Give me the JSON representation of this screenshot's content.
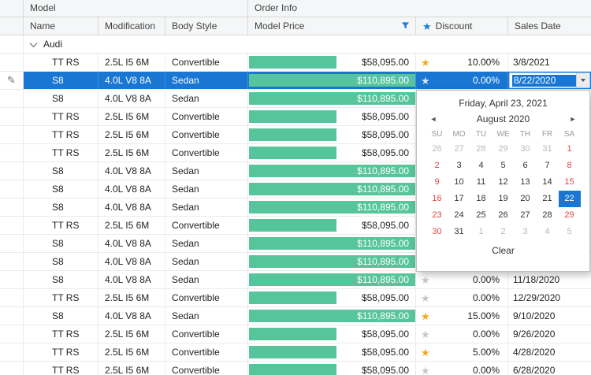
{
  "bands": {
    "model": "Model",
    "order_info": "Order Info"
  },
  "columns": {
    "name": "Name",
    "modification": "Modification",
    "body_style": "Body Style",
    "model_price": "Model Price",
    "discount": "Discount",
    "sales_date": "Sales Date"
  },
  "group": {
    "label": "Audi"
  },
  "max_price": 110895,
  "rows": [
    {
      "name": "TT RS",
      "modification": "2.5L I5 6M",
      "body_style": "Convertible",
      "price_label": "$58,095.00",
      "price_value": 58095,
      "star": "gold",
      "discount": "10.00%",
      "sales_date": "3/8/2021",
      "selected": false,
      "editing": false
    },
    {
      "name": "S8",
      "modification": "4.0L V8 8A",
      "body_style": "Sedan",
      "price_label": "$110,895.00",
      "price_value": 110895,
      "star": "light",
      "discount": "0.00%",
      "sales_date": "8/22/2020",
      "selected": true,
      "editing": true
    },
    {
      "name": "S8",
      "modification": "4.0L V8 8A",
      "body_style": "Sedan",
      "price_label": "$110,895.00",
      "price_value": 110895,
      "star": null,
      "discount": "",
      "sales_date": "",
      "selected": false,
      "editing": false
    },
    {
      "name": "TT RS",
      "modification": "2.5L I5 6M",
      "body_style": "Convertible",
      "price_label": "$58,095.00",
      "price_value": 58095,
      "star": null,
      "discount": "",
      "sales_date": "",
      "selected": false,
      "editing": false
    },
    {
      "name": "TT RS",
      "modification": "2.5L I5 6M",
      "body_style": "Convertible",
      "price_label": "$58,095.00",
      "price_value": 58095,
      "star": null,
      "discount": "",
      "sales_date": "",
      "selected": false,
      "editing": false
    },
    {
      "name": "TT RS",
      "modification": "2.5L I5 6M",
      "body_style": "Convertible",
      "price_label": "$58,095.00",
      "price_value": 58095,
      "star": null,
      "discount": "",
      "sales_date": "",
      "selected": false,
      "editing": false
    },
    {
      "name": "S8",
      "modification": "4.0L V8 8A",
      "body_style": "Sedan",
      "price_label": "$110,895.00",
      "price_value": 110895,
      "star": null,
      "discount": "",
      "sales_date": "",
      "selected": false,
      "editing": false
    },
    {
      "name": "S8",
      "modification": "4.0L V8 8A",
      "body_style": "Sedan",
      "price_label": "$110,895.00",
      "price_value": 110895,
      "star": null,
      "discount": "",
      "sales_date": "",
      "selected": false,
      "editing": false
    },
    {
      "name": "S8",
      "modification": "4.0L V8 8A",
      "body_style": "Sedan",
      "price_label": "$110,895.00",
      "price_value": 110895,
      "star": null,
      "discount": "",
      "sales_date": "",
      "selected": false,
      "editing": false
    },
    {
      "name": "TT RS",
      "modification": "2.5L I5 6M",
      "body_style": "Convertible",
      "price_label": "$58,095.00",
      "price_value": 58095,
      "star": null,
      "discount": "",
      "sales_date": "",
      "selected": false,
      "editing": false
    },
    {
      "name": "S8",
      "modification": "4.0L V8 8A",
      "body_style": "Sedan",
      "price_label": "$110,895.00",
      "price_value": 110895,
      "star": null,
      "discount": "",
      "sales_date": "",
      "selected": false,
      "editing": false
    },
    {
      "name": "S8",
      "modification": "4.0L V8 8A",
      "body_style": "Sedan",
      "price_label": "$110,895.00",
      "price_value": 110895,
      "star": null,
      "discount": "",
      "sales_date": "",
      "selected": false,
      "editing": false
    },
    {
      "name": "S8",
      "modification": "4.0L V8 8A",
      "body_style": "Sedan",
      "price_label": "$110,895.00",
      "price_value": 110895,
      "star": "gray",
      "discount": "0.00%",
      "sales_date": "11/18/2020",
      "selected": false,
      "editing": false
    },
    {
      "name": "TT RS",
      "modification": "2.5L I5 6M",
      "body_style": "Convertible",
      "price_label": "$58,095.00",
      "price_value": 58095,
      "star": "gray",
      "discount": "0.00%",
      "sales_date": "12/29/2020",
      "selected": false,
      "editing": false
    },
    {
      "name": "S8",
      "modification": "4.0L V8 8A",
      "body_style": "Sedan",
      "price_label": "$110,895.00",
      "price_value": 110895,
      "star": "gold",
      "discount": "15.00%",
      "sales_date": "9/10/2020",
      "selected": false,
      "editing": false
    },
    {
      "name": "TT RS",
      "modification": "2.5L I5 6M",
      "body_style": "Convertible",
      "price_label": "$58,095.00",
      "price_value": 58095,
      "star": "gray",
      "discount": "0.00%",
      "sales_date": "9/26/2020",
      "selected": false,
      "editing": false
    },
    {
      "name": "TT RS",
      "modification": "2.5L I5 6M",
      "body_style": "Convertible",
      "price_label": "$58,095.00",
      "price_value": 58095,
      "star": "gold",
      "discount": "5.00%",
      "sales_date": "4/28/2020",
      "selected": false,
      "editing": false
    },
    {
      "name": "TT RS",
      "modification": "2.5L I5 6M",
      "body_style": "Convertible",
      "price_label": "$58,095.00",
      "price_value": 58095,
      "star": "gray",
      "discount": "0.00%",
      "sales_date": "6/28/2020",
      "selected": false,
      "editing": false
    }
  ],
  "calendar": {
    "title": "Friday, April 23, 2021",
    "month_label": "August 2020",
    "weekdays": [
      "SU",
      "MO",
      "TU",
      "WE",
      "TH",
      "FR",
      "SA"
    ],
    "weeks": [
      [
        {
          "d": 26,
          "t": "muted"
        },
        {
          "d": 27,
          "t": "muted"
        },
        {
          "d": 28,
          "t": "muted"
        },
        {
          "d": 29,
          "t": "muted"
        },
        {
          "d": 30,
          "t": "muted"
        },
        {
          "d": 31,
          "t": "muted"
        },
        {
          "d": 1,
          "t": "weekend"
        }
      ],
      [
        {
          "d": 2,
          "t": "weekend"
        },
        {
          "d": 3,
          "t": "normal"
        },
        {
          "d": 4,
          "t": "normal"
        },
        {
          "d": 5,
          "t": "normal"
        },
        {
          "d": 6,
          "t": "normal"
        },
        {
          "d": 7,
          "t": "normal"
        },
        {
          "d": 8,
          "t": "weekend"
        }
      ],
      [
        {
          "d": 9,
          "t": "weekend"
        },
        {
          "d": 10,
          "t": "normal"
        },
        {
          "d": 11,
          "t": "normal"
        },
        {
          "d": 12,
          "t": "normal"
        },
        {
          "d": 13,
          "t": "normal"
        },
        {
          "d": 14,
          "t": "normal"
        },
        {
          "d": 15,
          "t": "weekend"
        }
      ],
      [
        {
          "d": 16,
          "t": "weekend"
        },
        {
          "d": 17,
          "t": "normal"
        },
        {
          "d": 18,
          "t": "normal"
        },
        {
          "d": 19,
          "t": "normal"
        },
        {
          "d": 20,
          "t": "normal"
        },
        {
          "d": 21,
          "t": "normal"
        },
        {
          "d": 22,
          "t": "selected"
        }
      ],
      [
        {
          "d": 23,
          "t": "weekend"
        },
        {
          "d": 24,
          "t": "normal"
        },
        {
          "d": 25,
          "t": "normal"
        },
        {
          "d": 26,
          "t": "normal"
        },
        {
          "d": 27,
          "t": "normal"
        },
        {
          "d": 28,
          "t": "normal"
        },
        {
          "d": 29,
          "t": "weekend"
        }
      ],
      [
        {
          "d": 30,
          "t": "weekend"
        },
        {
          "d": 31,
          "t": "normal"
        },
        {
          "d": 1,
          "t": "muted"
        },
        {
          "d": 2,
          "t": "muted"
        },
        {
          "d": 3,
          "t": "muted"
        },
        {
          "d": 4,
          "t": "muted"
        },
        {
          "d": 5,
          "t": "muted"
        }
      ]
    ],
    "clear_label": "Clear"
  },
  "icons": {
    "star": "★",
    "pencil": "✎",
    "prev": "◄",
    "next": "►"
  },
  "colors": {
    "accent": "#1976d2",
    "bar_green": "#57c59b",
    "star_gold": "#f2a71c",
    "star_gray": "#c6c6c6",
    "weekend_red": "#e04545",
    "header_bg": "#f5f6f7"
  }
}
